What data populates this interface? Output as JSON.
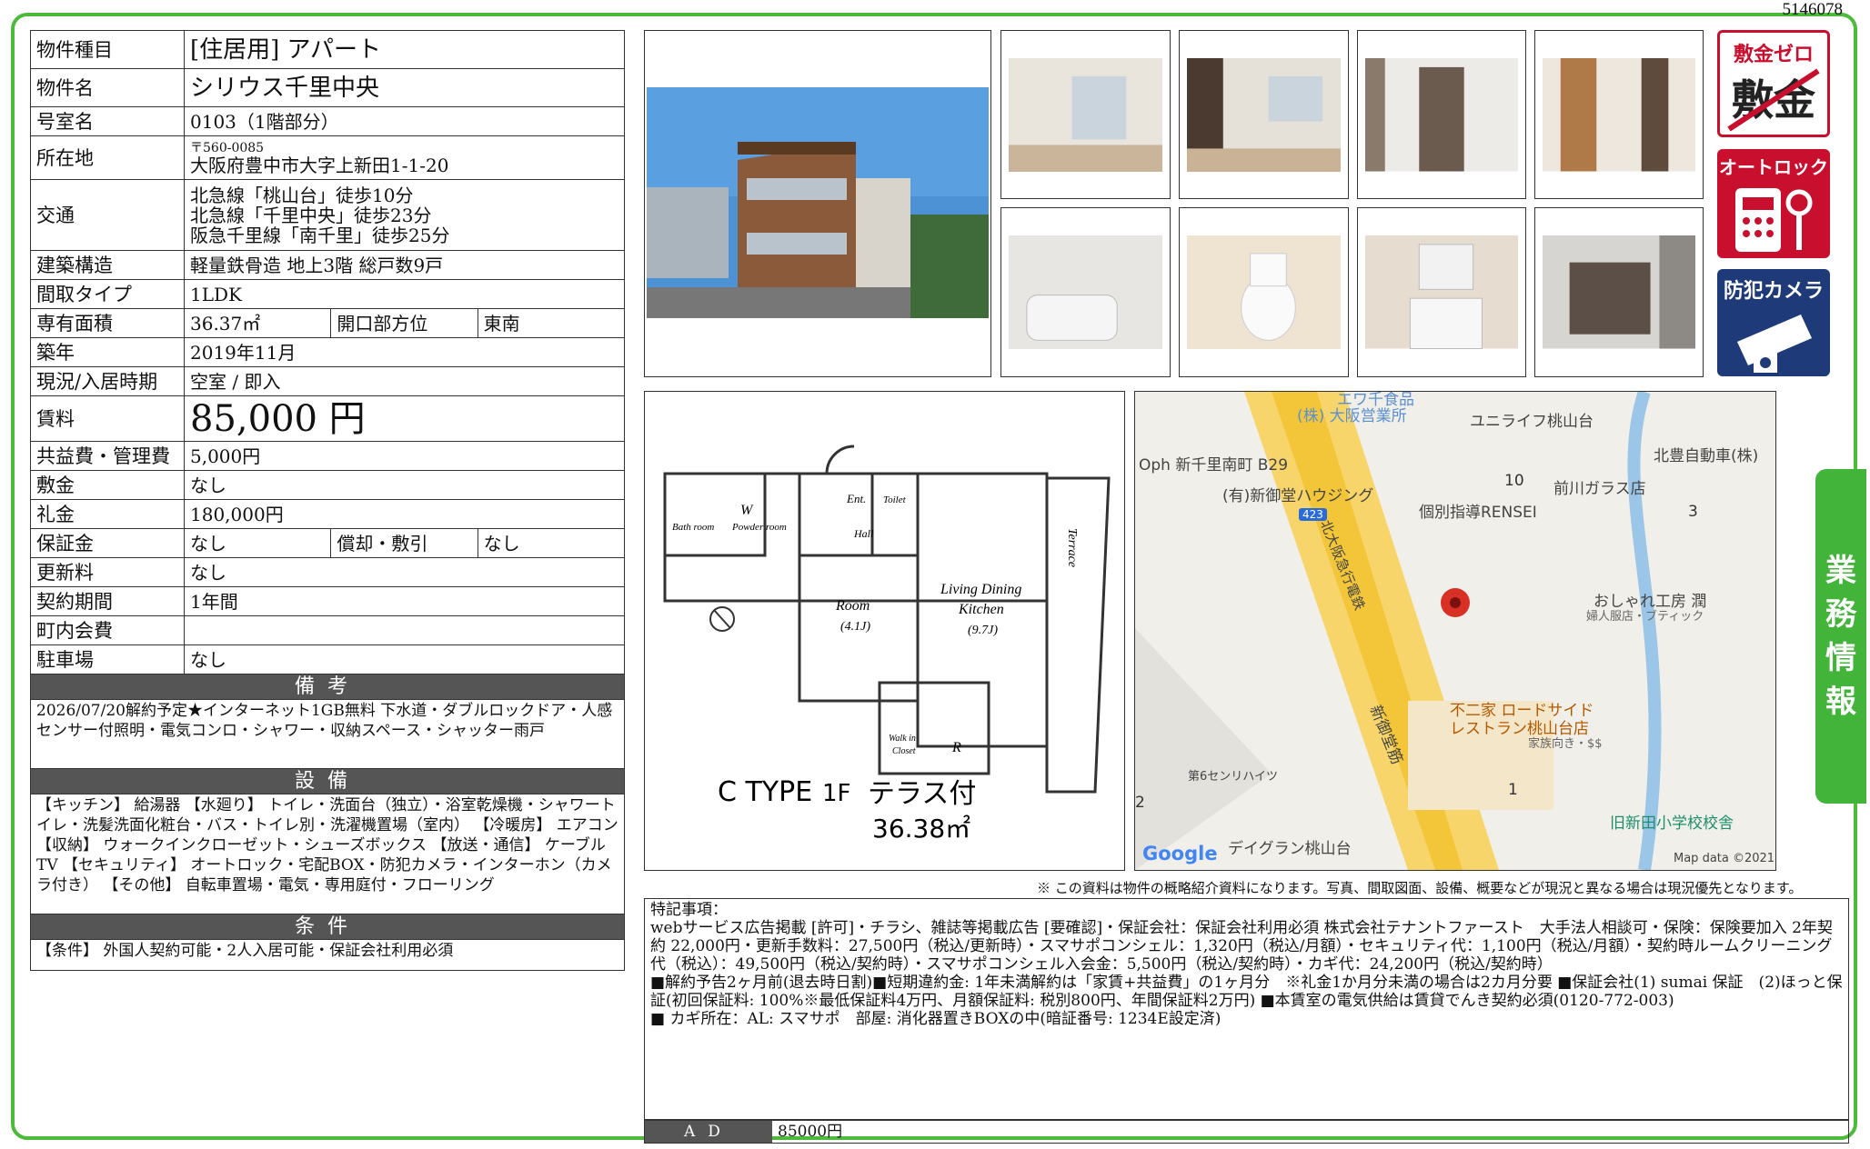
{
  "doc_id": "5146078",
  "spec": {
    "type": {
      "label": "物件種目",
      "value": "[住居用] アパート"
    },
    "name": {
      "label": "物件名",
      "value": "シリウス千里中央"
    },
    "room": {
      "label": "号室名",
      "value": "0103（1階部分）"
    },
    "address": {
      "label": "所在地",
      "zip": "〒560-0085",
      "value": "大阪府豊中市大字上新田1-1-20"
    },
    "access": {
      "label": "交通",
      "line1": "北急線「桃山台」徒歩10分",
      "line2": "北急線「千里中央」徒歩23分",
      "line3": "阪急千里線「南千里」徒歩25分"
    },
    "structure": {
      "label": "建築構造",
      "value": "軽量鉄骨造 地上3階 総戸数9戸"
    },
    "layout": {
      "label": "間取タイプ",
      "value": "1LDK"
    },
    "area": {
      "label": "専有面積",
      "value": "36.37㎡",
      "dir_label": "開口部方位",
      "dir_value": "東南"
    },
    "built": {
      "label": "築年",
      "value": "2019年11月"
    },
    "status": {
      "label": "現況/入居時期",
      "value": "空室 / 即入"
    },
    "rent": {
      "label": "賃料",
      "value": "85,000 円"
    },
    "fee": {
      "label": "共益費・管理費",
      "value": "5,000円"
    },
    "deposit": {
      "label": "敷金",
      "value": "なし"
    },
    "key_money": {
      "label": "礼金",
      "value": "180,000円"
    },
    "guarantee": {
      "label": "保証金",
      "value": "なし",
      "amort_label": "償却・敷引",
      "amort_value": "なし"
    },
    "renewal": {
      "label": "更新料",
      "value": "なし"
    },
    "term": {
      "label": "契約期間",
      "value": "1年間"
    },
    "town_fee": {
      "label": "町内会費",
      "value": ""
    },
    "parking": {
      "label": "駐車場",
      "value": "なし"
    }
  },
  "remarks": {
    "title": "備考",
    "text": "2026/07/20解約予定★インターネット1GB無料 下水道・ダブルロックドア・人感センサー付照明・電気コンロ・シャワー・収納スペース・シャッター雨戸"
  },
  "equipment": {
    "title": "設備",
    "text": "【キッチン】 給湯器 【水廻り】 トイレ・洗面台（独立）・浴室乾燥機・シャワートイレ・洗髪洗面化粧台・バス・トイレ別・洗濯機置場（室内） 【冷暖房】 エアコン 【収納】 ウォークインクローゼット・シューズボックス 【放送・通信】 ケーブルTV 【セキュリティ】 オートロック・宅配BOX・防犯カメラ・インターホン（カメラ付き） 【その他】 自転車置場・電気・専用庭付・フローリング"
  },
  "conditions": {
    "title": "条件",
    "text": "【条件】 外国人契約可能・2人入居可能・保証会社利用必須"
  },
  "badges": {
    "zero_top": "敷金ゼロ",
    "zero_big": "敷金",
    "autolock": "オートロック",
    "camera": "防犯カメラ"
  },
  "floorplan": {
    "type_label": "C TYPE",
    "floor": "1F",
    "terrace": "テラス付",
    "area": "36.38㎡",
    "rooms": {
      "bath": "Bath room",
      "powder": "Powder room",
      "ent": "Ent.",
      "toilet": "Toilet",
      "hall": "Hall",
      "room": "Room",
      "room_size": "(4.1J)",
      "ldk1": "Living Dining",
      "ldk2": "Kitchen",
      "ldk_size": "(9.7J)",
      "terrace_v": "Terrace",
      "closet1": "Walk in",
      "closet2": "Closet",
      "w": "W",
      "r": "R"
    }
  },
  "map": {
    "labels": {
      "a": "エワ千食品",
      "b": "(株) 大阪営業所",
      "c": "ユニライフ桃山台",
      "d": "Oph 新千里南町 B29",
      "e": "北豊自動車(株)",
      "f": "(有)新御堂ハウジング",
      "g": "前川ガラス店",
      "h": "個別指導RENSEI",
      "i": "北大阪急行電鉄",
      "j": "おしゃれ工房 潤",
      "k": "婦人服店・ブティック",
      "l": "新御堂筋",
      "m": "不二家 ロードサイド",
      "n": "レストラン桃山台店",
      "o": "家族向き・$$",
      "p": "第6センリハイツ",
      "q": "デイグラン桃山台",
      "r": "旧新田小学校校舎",
      "route": "423",
      "num10": "10",
      "num3": "3",
      "num1": "1",
      "num2": "2"
    },
    "google": "Google",
    "credit": "Map data ©2021"
  },
  "note": "※ この資料は物件の概略紹介資料になります。写真、間取図面、設備、概要などが現況と異なる場合は現況優先となります。",
  "tokki": {
    "title": "特記事項：",
    "l1": "webサービス広告掲載 [許可]・チラシ、雑誌等掲載広告 [要確認]・保証会社：保証会社利用必須 株式会社テナントファースト　大手法人相談可・保険：保険要加入 2年契約 22,000円・更新手数料：27,500円（税込/更新時）・スマサポコンシェル：1,320円（税込/月額）・セキュリティ代：1,100円（税込/月額）・契約時ルームクリーニング代（税込）：49,500円（税込/契約時）・スマサポコンシェル入会金：5,500円（税込/契約時）・カギ代：24,200円（税込/契約時）",
    "l2": "■解約予告2ヶ月前(退去時日割)■短期違約金: 1年未満解約は「家賃+共益費」の1ヶ月分　※礼金1か月分未満の場合は2カ月分要 ■保証会社(1) sumai 保証　(2)ほっと保証(初回保証料: 100%※最低保証料4万円、月額保証料: 税別800円、年間保証料2万円) ■本賃室の電気供給は賃貸でんき契約必須(0120-772-003)",
    "l3": "■ カギ所在：AL: スマサポ　部屋: 消化器置きBOXの中(暗証番号: 1234E設定済)"
  },
  "ad": {
    "label": "AD",
    "value": "85000円"
  },
  "side_tab": [
    "業",
    "務",
    "情",
    "報"
  ]
}
